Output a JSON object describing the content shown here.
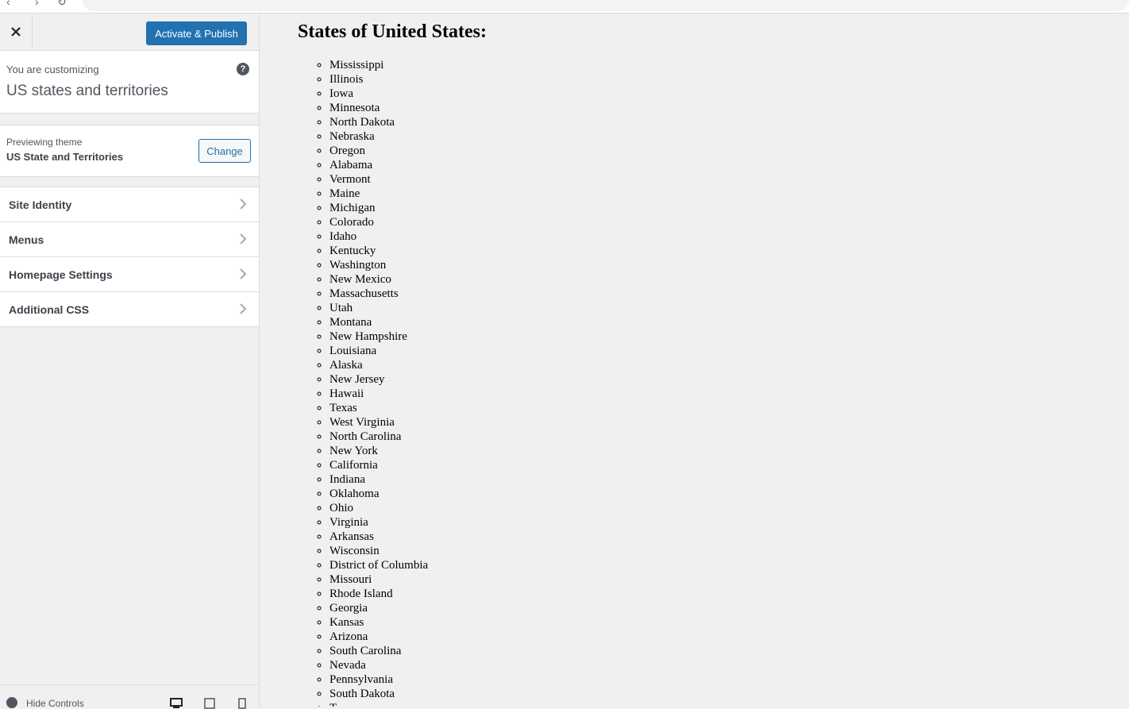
{
  "customizer": {
    "close_label": "×",
    "publish_button": "Activate & Publish",
    "customizing_label": "You are customizing",
    "site_title": "US states and territories",
    "help_icon": "?",
    "theme_label": "Previewing theme",
    "theme_name": "US State and Territories",
    "change_button": "Change",
    "sections": [
      {
        "label": "Site Identity"
      },
      {
        "label": "Menus"
      },
      {
        "label": "Homepage Settings"
      },
      {
        "label": "Additional CSS"
      }
    ],
    "hide_controls": "Hide Controls"
  },
  "preview": {
    "heading": "States of United States:",
    "states": [
      "Mississippi",
      "Illinois",
      "Iowa",
      "Minnesota",
      "North Dakota",
      "Nebraska",
      "Oregon",
      "Alabama",
      "Vermont",
      "Maine",
      "Michigan",
      "Colorado",
      "Idaho",
      "Kentucky",
      "Washington",
      "New Mexico",
      "Massachusetts",
      "Utah",
      "Montana",
      "New Hampshire",
      "Louisiana",
      "Alaska",
      "New Jersey",
      "Hawaii",
      "Texas",
      "West Virginia",
      "North Carolina",
      "New York",
      "California",
      "Indiana",
      "Oklahoma",
      "Ohio",
      "Virginia",
      "Arkansas",
      "Wisconsin",
      "District of Columbia",
      "Missouri",
      "Rhode Island",
      "Georgia",
      "Kansas",
      "Arizona",
      "South Carolina",
      "Nevada",
      "Pennsylvania",
      "South Dakota",
      "T"
    ]
  },
  "colors": {
    "accent": "#2271b1",
    "sidebar_bg": "#f0f0f1",
    "text": "#3c434a"
  }
}
